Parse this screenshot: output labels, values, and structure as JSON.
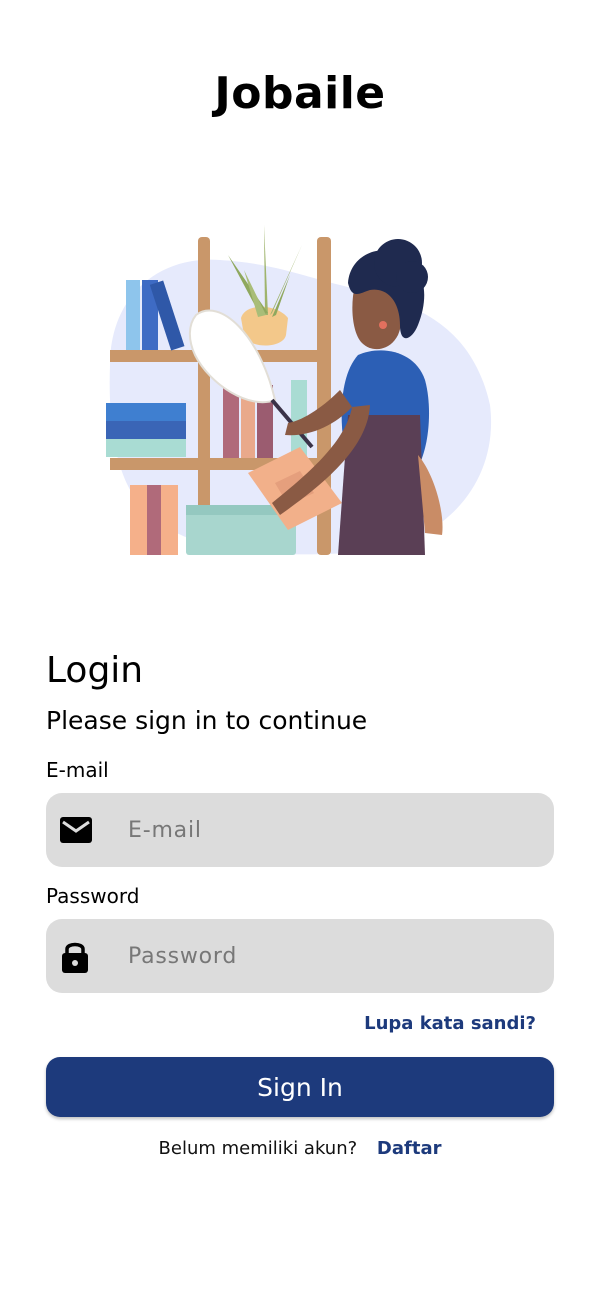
{
  "app": {
    "title": "Jobaile"
  },
  "login": {
    "heading": "Login",
    "subtitle": "Please sign in to continue"
  },
  "email": {
    "label": "E-mail",
    "placeholder": "E-mail",
    "value": "",
    "icon": "mail-icon"
  },
  "password": {
    "label": "Password",
    "placeholder": "Password",
    "value": "",
    "icon": "lock-icon"
  },
  "forgot": {
    "label": "Lupa kata sandi?"
  },
  "signin": {
    "label": "Sign In"
  },
  "register": {
    "prompt": "Belum memiliki akun?",
    "link": "Daftar"
  },
  "colors": {
    "accent": "#1d3a7c",
    "input_bg": "#dcdcdc"
  }
}
